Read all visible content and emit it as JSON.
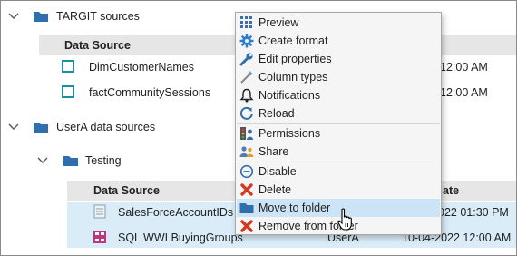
{
  "tree": {
    "group1": {
      "label": "TARGIT sources"
    },
    "group1_table": {
      "col_source": "Data Source",
      "rows": [
        {
          "name": "DimCustomerNames",
          "date": "12:00 AM"
        },
        {
          "name": "factCommunitySessions",
          "date": "12:00 AM"
        }
      ]
    },
    "group2": {
      "label": "UserA data sources"
    },
    "subfolder": {
      "label": "Testing"
    },
    "group2_table": {
      "col_source": "Data Source",
      "col_date": "Date",
      "col_date_visible": "ate",
      "rows": [
        {
          "name": "SalesForceAccountIDs",
          "owner": "",
          "date": "022 01:30 PM"
        },
        {
          "name": "SQL WWI BuyingGroups",
          "owner": "UserA",
          "date": "10-04-2022 12:00 AM"
        }
      ]
    }
  },
  "context_menu": {
    "items": [
      {
        "label": "Preview",
        "icon": "grid-icon"
      },
      {
        "label": "Create format",
        "icon": "gear-icon"
      },
      {
        "label": "Edit properties",
        "icon": "wrench-icon"
      },
      {
        "label": "Column types",
        "icon": "wand-icon"
      },
      {
        "label": "Notifications",
        "icon": "bell-icon"
      },
      {
        "label": "Reload",
        "icon": "reload-icon"
      },
      {
        "label": "Permissions",
        "icon": "permissions-icon"
      },
      {
        "label": "Share",
        "icon": "share-icon"
      },
      {
        "label": "Disable",
        "icon": "disable-icon"
      },
      {
        "label": "Delete",
        "icon": "delete-icon"
      },
      {
        "label": "Move to folder",
        "icon": "folder-icon"
      },
      {
        "label": "Remove from folder",
        "icon": "remove-icon"
      }
    ],
    "hovered_item": "Move to folder"
  },
  "colors": {
    "folder": "#2f6fad",
    "selection": "#d9ecf8",
    "menu_hover": "#cde4f7",
    "header_band": "#e6e6e6",
    "source_icon": "#1a8fa6"
  }
}
